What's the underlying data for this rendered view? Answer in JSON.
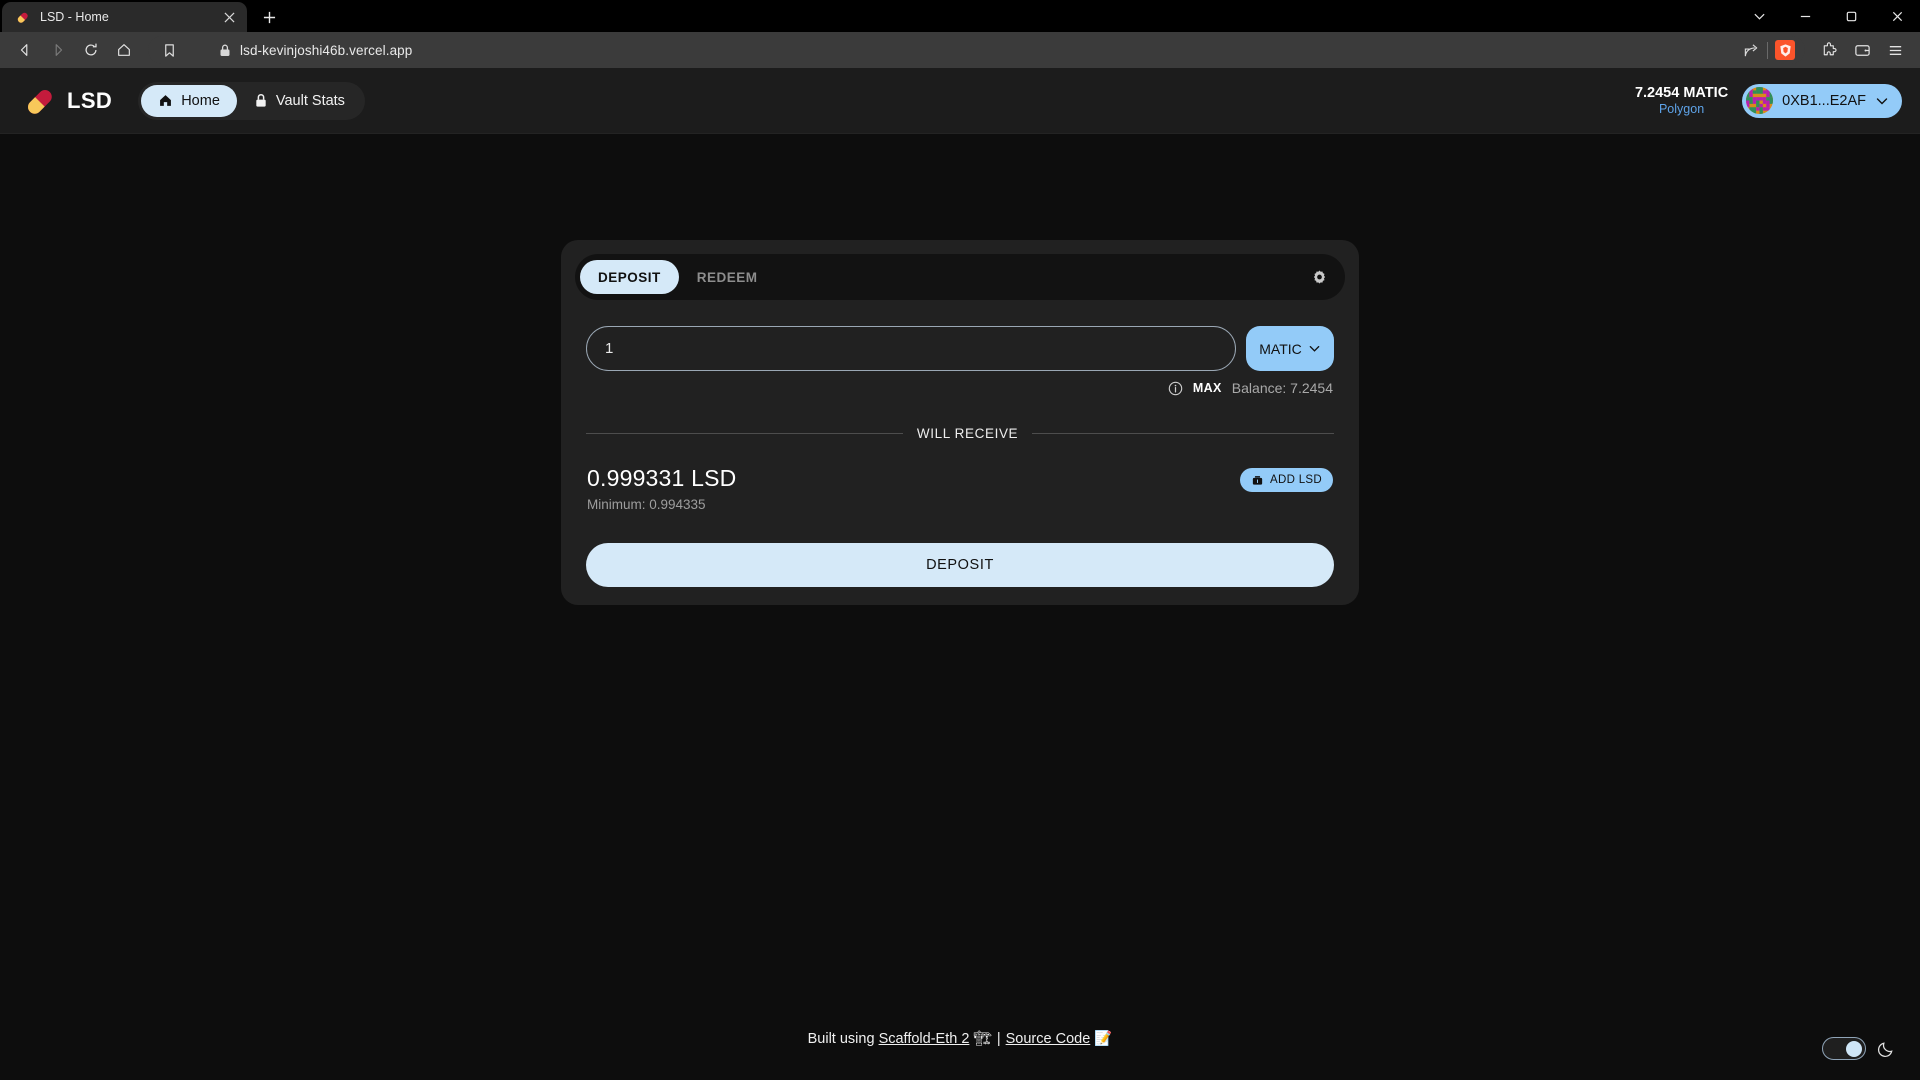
{
  "browser": {
    "tab": {
      "title": "LSD - Home",
      "favicon_icon": "pill-capsule-icon",
      "close_icon": "close-icon"
    },
    "new_tab_icon": "plus-icon",
    "window_controls": [
      {
        "name": "tab-search",
        "icon": "chevron-down-icon"
      },
      {
        "name": "minimize",
        "icon": "minimize-icon"
      },
      {
        "name": "maximize",
        "icon": "restore-icon"
      },
      {
        "name": "close",
        "icon": "close-icon"
      }
    ],
    "toolbar": {
      "back_icon": "back-arrow-icon",
      "forward_icon": "forward-arrow-icon",
      "reload_icon": "reload-icon",
      "home_icon": "home-icon",
      "bookmark_icon": "bookmark-icon",
      "lock_icon": "lock-icon",
      "url": "lsd-kevinjoshi46b.vercel.app",
      "share_icon": "share-icon",
      "shields_icon": "brave-shields-lion-icon",
      "extensions_icon": "puzzle-piece-icon",
      "wallet_icon": "brave-wallet-icon",
      "menu_icon": "hamburger-menu-icon"
    }
  },
  "app": {
    "brand": {
      "name": "LSD",
      "logo_icon": "pill-capsule-logo"
    },
    "nav": [
      {
        "label": "Home",
        "icon": "home-icon",
        "active": true
      },
      {
        "label": "Vault Stats",
        "icon": "lock-icon",
        "active": false
      }
    ],
    "wallet": {
      "balance": "7.2454 MATIC",
      "network": "Polygon",
      "address": "0XB1...E2AF",
      "avatar_icon": "blockie-avatar",
      "chevron_icon": "chevron-down-icon"
    }
  },
  "card": {
    "tabs": [
      {
        "label": "DEPOSIT",
        "active": true
      },
      {
        "label": "REDEEM",
        "active": false
      }
    ],
    "settings_icon": "gear-icon",
    "amount": {
      "value": "1",
      "placeholder": "0.0"
    },
    "token": {
      "label": "MATIC",
      "chevron_icon": "chevron-down-icon"
    },
    "meta": {
      "info_icon": "info-circle-icon",
      "max_label": "MAX",
      "balance_label": "Balance: 7.2454"
    },
    "divider_label": "WILL RECEIVE",
    "receive": {
      "amount": "0.999331 LSD",
      "minimum": "Minimum: 0.994335",
      "add_token_label": "ADD LSD",
      "add_token_icon": "wallet-icon"
    },
    "cta_label": "DEPOSIT"
  },
  "footer": {
    "built_using": "Built using ",
    "scaffold_link": "Scaffold-Eth 2",
    "scaffold_emoji": "🏗",
    "separator": "|",
    "source_link": "Source Code",
    "source_emoji": "📝",
    "theme_toggle": {
      "state": "on",
      "icon": "moon-icon"
    }
  },
  "colors": {
    "accent_light": "#d5e9f8",
    "accent": "#93cbf8",
    "page_bg": "#0d0d0d",
    "card_bg": "#212121",
    "network": "#5ea3e8"
  }
}
